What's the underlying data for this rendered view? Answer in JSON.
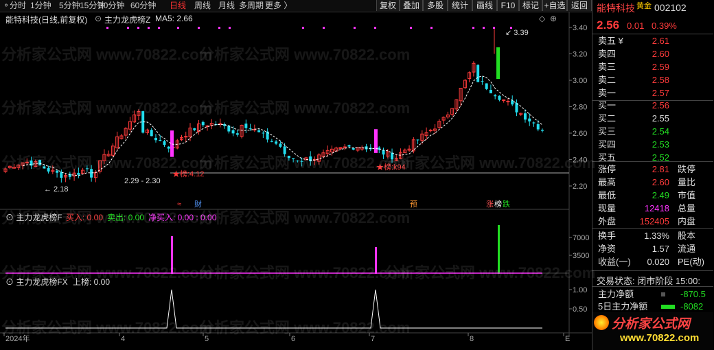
{
  "toolbar": {
    "periods": [
      "分时",
      "1分钟",
      "5分钟",
      "15分钟",
      "30分钟",
      "60分钟",
      "日线",
      "周线",
      "月线",
      "多周期",
      "更多 〉"
    ],
    "active_period": "日线",
    "buttons": [
      "复权",
      "叠加",
      "多股",
      "统计",
      "画线",
      "F10",
      "标记",
      "+自选",
      "返回"
    ]
  },
  "chart": {
    "title": "能特科技(日线,前复权)",
    "indicator": "主力龙虎榜Z",
    "ma_label": "MA5: 2.66",
    "price_ticks": [
      "3.40",
      "3.20",
      "3.00",
      "2.80",
      "2.60",
      "2.40",
      "2.20"
    ],
    "annotations": {
      "high": "3.39",
      "low1": "2.18",
      "range": "2.29 - 2.30",
      "bang1": "榜:4.12",
      "bang2": "榜:k94"
    },
    "markers": {
      "cai": "财",
      "yu": "预",
      "zhang": "涨",
      "bang": "榜",
      "die": "跌"
    }
  },
  "panel2": {
    "name": "主力龙虎榜F",
    "buy": "买入: 0.00",
    "sell": "卖出: 0.00",
    "net": "净买入: 0.00 : 0.00",
    "ticks": [
      "7000",
      "3500"
    ]
  },
  "panel3": {
    "name": "主力龙虎榜FX",
    "value": "上榜: 0.00",
    "ticks": [
      "1.00",
      "0.50"
    ]
  },
  "xaxis": {
    "labels": [
      "2024年",
      "4",
      "5",
      "6",
      "7",
      "8",
      "E"
    ]
  },
  "quote": {
    "name": "能特科技",
    "board": "黄金",
    "code": "002102",
    "price": "2.56",
    "change": "0.01",
    "pct": "0.39%",
    "asks": [
      {
        "label": "卖五 ¥",
        "price": "2.61"
      },
      {
        "label": "卖四",
        "price": "2.60"
      },
      {
        "label": "卖三",
        "price": "2.59"
      },
      {
        "label": "卖二",
        "price": "2.58"
      },
      {
        "label": "卖一",
        "price": "2.57"
      }
    ],
    "bids": [
      {
        "label": "买一",
        "price": "2.56"
      },
      {
        "label": "买二",
        "price": "2.55"
      },
      {
        "label": "买三",
        "price": "2.54"
      },
      {
        "label": "买四",
        "price": "2.53"
      },
      {
        "label": "买五",
        "price": "2.52"
      }
    ],
    "stats": [
      {
        "l1": "涨停",
        "v1": "2.81",
        "c1": "red",
        "l2": "跌停"
      },
      {
        "l1": "最高",
        "v1": "2.60",
        "c1": "red",
        "l2": "量比"
      },
      {
        "l1": "最低",
        "v1": "2.49",
        "c1": "green",
        "l2": "市值"
      },
      {
        "l1": "现量",
        "v1": "12418",
        "c1": "magenta",
        "l2": "总量"
      },
      {
        "l1": "外盘",
        "v1": "152405",
        "c1": "red",
        "l2": "内盘"
      }
    ],
    "stats2": [
      {
        "l1": "换手",
        "v1": "1.33%",
        "l2": "股本"
      },
      {
        "l1": "净资",
        "v1": "1.57",
        "l2": "流通"
      },
      {
        "l1": "收益(一)",
        "v1": "0.020",
        "l2": "PE(动)"
      }
    ],
    "trade_status": "交易状态: 闭市阶段 15:00:",
    "flow": [
      {
        "label": "主力净额",
        "value": "-870.5"
      },
      {
        "label": "5日主力净额",
        "value": "-8082"
      }
    ],
    "logo_text": "分析家公式网",
    "logo_url": "www.70822.com"
  },
  "watermark": "分析家公式网 www.70822.com",
  "colors": {
    "up": "#ff3b3b",
    "down": "#22ddee",
    "magenta": "#ff33ff",
    "green": "#22dd22"
  }
}
